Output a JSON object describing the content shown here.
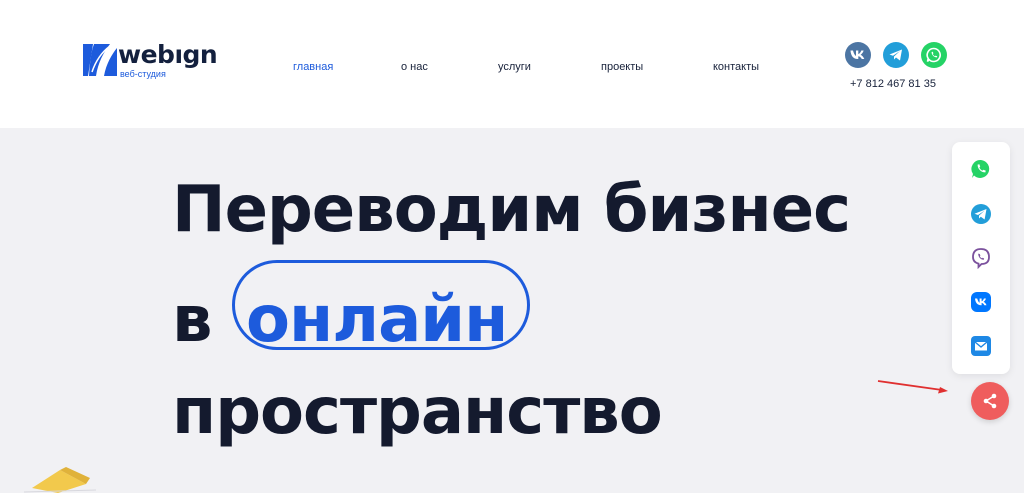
{
  "logo": {
    "name": "webıgn",
    "subtitle": "веб-студия",
    "mark_color": "#1d5bdc"
  },
  "nav": {
    "items": [
      {
        "label": "главная",
        "active": true
      },
      {
        "label": "о нас",
        "active": false
      },
      {
        "label": "услуги",
        "active": false
      },
      {
        "label": "проекты",
        "active": false
      },
      {
        "label": "контакты",
        "active": false
      }
    ]
  },
  "header_social": [
    {
      "icon": "vk-icon",
      "color": "#4c75a3"
    },
    {
      "icon": "telegram-icon",
      "color": "#229ed9"
    },
    {
      "icon": "whatsapp-icon",
      "color": "#25d366"
    }
  ],
  "phone": "+7 812 467 81 35",
  "hero": {
    "line1": "Переводим бизнес",
    "line2_prefix": "в",
    "line2_highlight": "онлайн",
    "line3": "пространство",
    "accent_color": "#1d5bdc"
  },
  "share_panel": {
    "icons": [
      {
        "icon": "whatsapp-icon",
        "color": "#25d366"
      },
      {
        "icon": "telegram-icon",
        "color": "#229ed9"
      },
      {
        "icon": "viber-icon",
        "color": "#7b519d"
      },
      {
        "icon": "vk-icon",
        "color": "#0077ff"
      },
      {
        "icon": "email-icon",
        "color": "#1e88e5"
      }
    ],
    "toggle_icon": "share-icon",
    "toggle_color": "#ef5d5d"
  }
}
